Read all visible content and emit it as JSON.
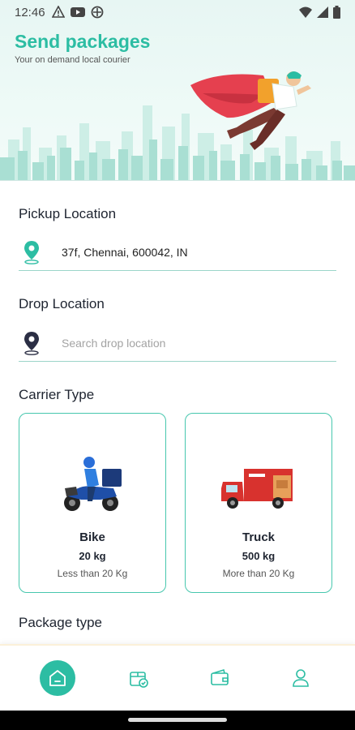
{
  "status_bar": {
    "time": "12:46",
    "icons": [
      "alert-icon",
      "youtube-icon",
      "vpn-icon",
      "wifi-icon",
      "signal-icon",
      "battery-icon"
    ]
  },
  "header": {
    "title": "Send packages",
    "subtitle": "Your on demand local courier",
    "accent_color": "#2cbda3"
  },
  "pickup": {
    "label": "Pickup Location",
    "value": "37f, Chennai, 600042, IN"
  },
  "drop": {
    "label": "Drop Location",
    "placeholder": "Search drop location"
  },
  "carrier": {
    "label": "Carrier Type",
    "options": [
      {
        "title": "Bike",
        "weight": "20 kg",
        "desc": "Less than 20 Kg"
      },
      {
        "title": "Truck",
        "weight": "500 kg",
        "desc": "More than 20 Kg"
      }
    ]
  },
  "package": {
    "label": "Package type"
  },
  "nav": {
    "items": [
      "home-icon",
      "packages-icon",
      "wallet-icon",
      "profile-icon"
    ],
    "active": "home-icon"
  }
}
